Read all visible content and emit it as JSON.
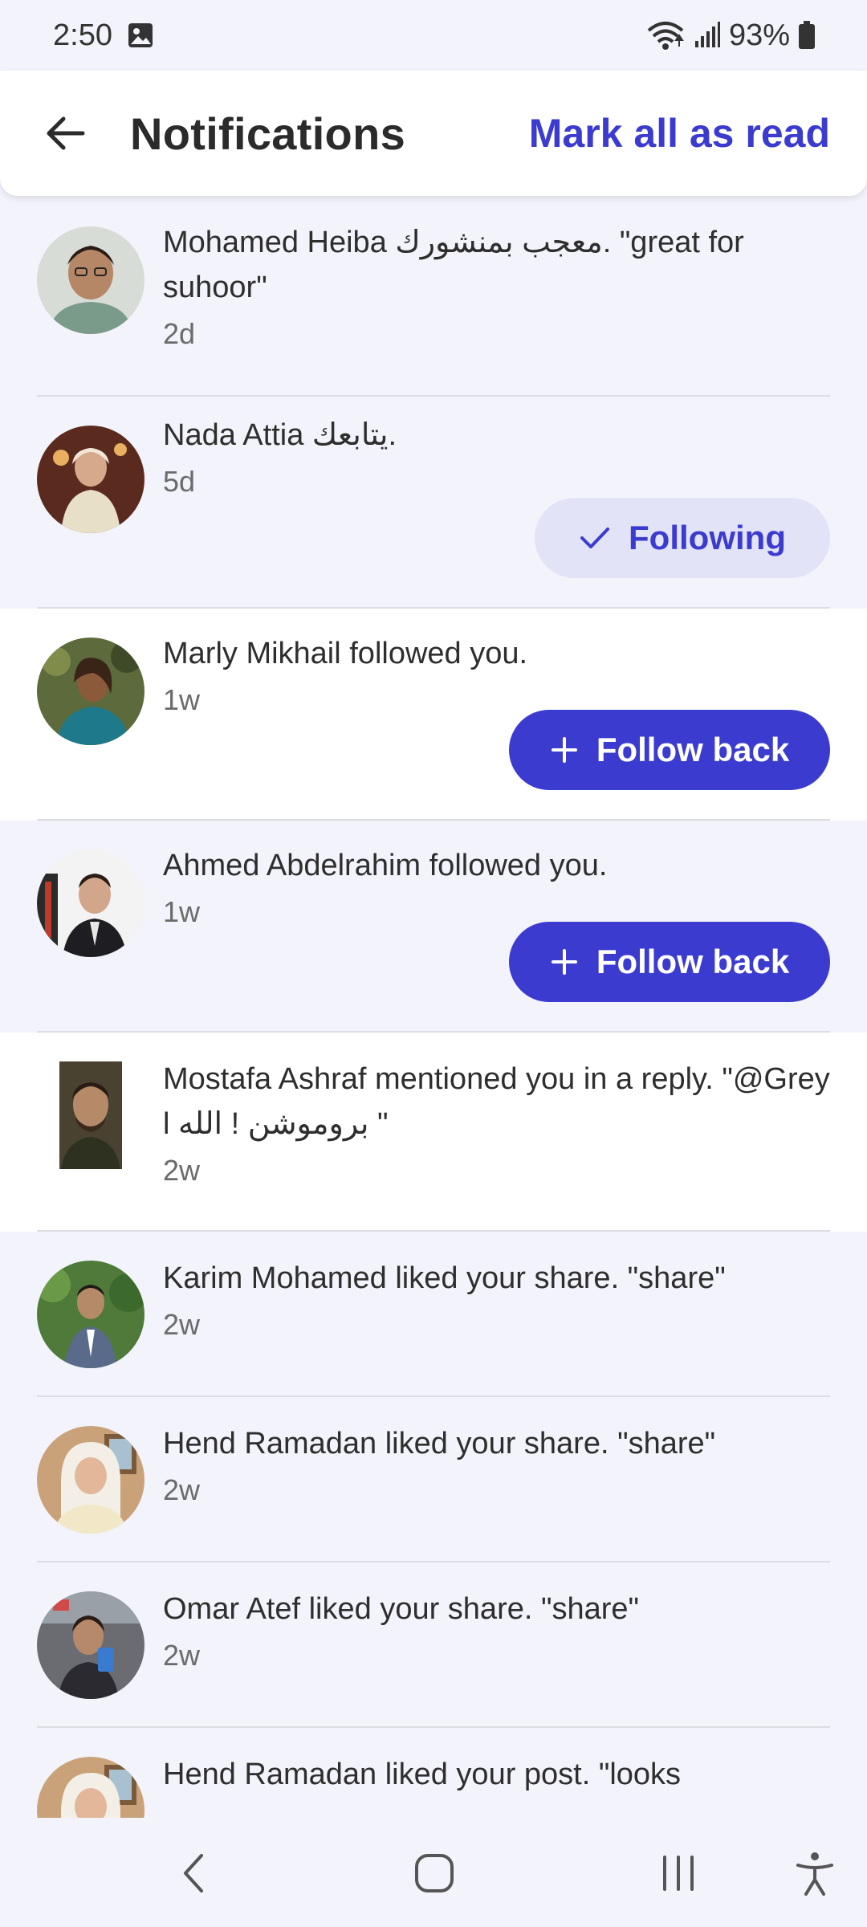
{
  "status": {
    "time": "2:50",
    "battery": "93%",
    "icons": [
      "gallery-icon",
      "wifi-icon",
      "signal-icon",
      "battery-icon"
    ]
  },
  "header": {
    "title": "Notifications",
    "mark_all_label": "Mark all as read",
    "back_icon": "arrow-left-icon"
  },
  "colors": {
    "accent": "#3b3bd0",
    "unread_bg": "#f2f3fb",
    "read_bg": "#ffffff",
    "following_bg": "#e3e3f7"
  },
  "notifications": [
    {
      "message": "Mohamed Heiba معجب بمنشورك. \"great for suhoor\"",
      "time": "2d",
      "state": "unread"
    },
    {
      "message": "Nada Attia يتابعك.",
      "time": "5d",
      "state": "unread",
      "button": {
        "label": "Following",
        "icon": "check-icon"
      }
    },
    {
      "message": "Marly Mikhail followed you.",
      "time": "1w",
      "state": "read",
      "button": {
        "label": "Follow back",
        "icon": "plus-icon"
      }
    },
    {
      "message": "Ahmed Abdelrahim followed you.",
      "time": "1w",
      "state": "unread",
      "button": {
        "label": "Follow back",
        "icon": "plus-icon"
      }
    },
    {
      "message": "Mostafa Ashraf mentioned you in a reply. \"@Grey l بروموشن ! الله \"",
      "time": "2w",
      "state": "read"
    },
    {
      "message": "Karim Mohamed liked your share. \"share\"",
      "time": "2w",
      "state": "unread"
    },
    {
      "message": "Hend Ramadan liked your share. \"share\"",
      "time": "2w",
      "state": "unread"
    },
    {
      "message": "Omar Atef liked your share. \"share\"",
      "time": "2w",
      "state": "unread"
    },
    {
      "message": "Hend Ramadan liked your post. \"looks",
      "time": "",
      "state": "unread"
    }
  ],
  "navbar": {
    "icons": [
      "nav-back-icon",
      "home-icon",
      "recents-icon",
      "accessibility-icon"
    ]
  }
}
